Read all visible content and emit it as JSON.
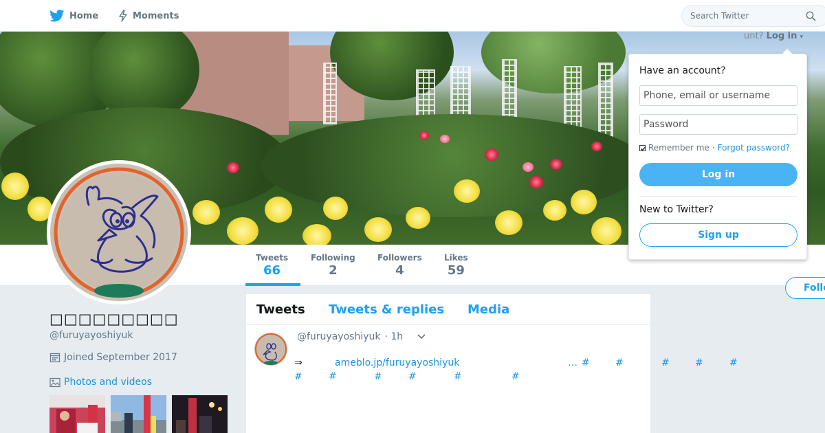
{
  "nav": {
    "home_label": "Home",
    "moments_label": "Moments",
    "search_placeholder": "Search Twitter"
  },
  "login": {
    "trigger_prefix": "unt?",
    "trigger_label": "Log in",
    "title": "Have an account?",
    "username_placeholder": "Phone, email or username",
    "password_placeholder": "Password",
    "remember_label": "Remember me",
    "separator": "·",
    "forgot_label": "Forgot password?",
    "login_button": "Log in",
    "new_label": "New to Twitter?",
    "signup_button": "Sign up"
  },
  "profile": {
    "display_name": "□□□□□□□□□",
    "screen_name": "@furuyayoshiyuk",
    "joined": "Joined September 2017",
    "photos_label": "Photos and videos",
    "follow_label": "Follo"
  },
  "stats": [
    {
      "label": "Tweets",
      "value": "66",
      "active": true
    },
    {
      "label": "Following",
      "value": "2",
      "active": false
    },
    {
      "label": "Followers",
      "value": "4",
      "active": false
    },
    {
      "label": "Likes",
      "value": "59",
      "active": false
    }
  ],
  "timeline": {
    "tabs": [
      "Tweets",
      "Tweets & replies",
      "Media"
    ],
    "tweet": {
      "handle": "@furuyayoshiyuk",
      "time": "· 1h",
      "arrow": "⇒",
      "link": "ameblo.jp/furuyayoshiyuk",
      "ellipsis": "…",
      "hashtag": "#"
    }
  },
  "colors": {
    "accent": "#1da1f2",
    "link": "#1b95e0",
    "muted": "#657786",
    "background": "#e6ecf0"
  },
  "icons": [
    "twitter-bird-icon",
    "lightning-icon",
    "search-icon",
    "calendar-icon",
    "photo-icon",
    "chevron-down-icon"
  ]
}
